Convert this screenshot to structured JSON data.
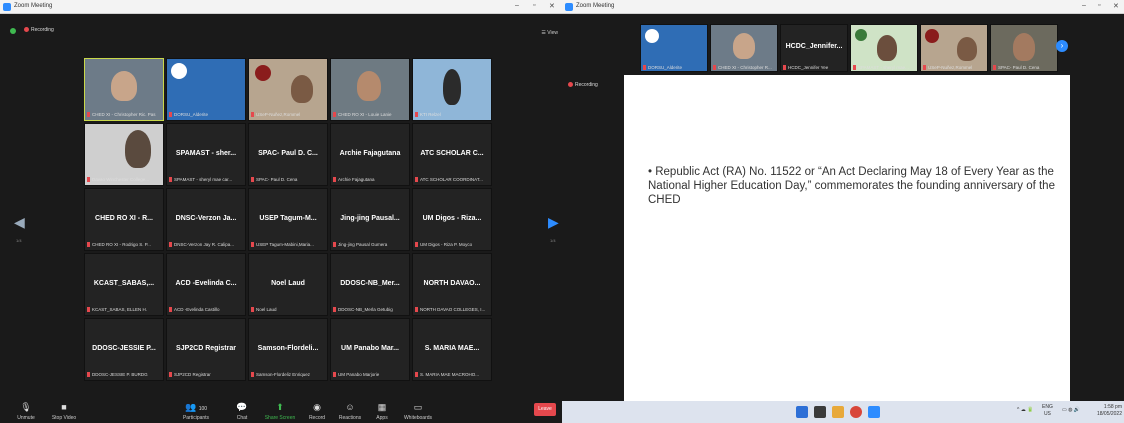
{
  "left_window": {
    "title": "Zoom Meeting",
    "recording": "Recording",
    "view": "View",
    "page_indicator": "1/4",
    "video_tiles": [
      {
        "name": "CHED XI - Christopher Ric. Pas"
      },
      {
        "name": "DORSU_Alderite"
      },
      {
        "name": "USeP-Nuñez,Rommel"
      },
      {
        "name": "CHED RO XI - Louie Lanie"
      },
      {
        "name": "KTI Relzel"
      },
      {
        "name": "Davao Winchester College..."
      }
    ],
    "text_tiles": [
      {
        "big": "SPAMAST - sher...",
        "name": "SPAMAST - sheryl mae car..."
      },
      {
        "big": "SPAC- Paul D. C...",
        "name": "SPAC- Paul D. Cena"
      },
      {
        "big": "Archie Fajagutana",
        "name": "Archie Fajagutana"
      },
      {
        "big": "ATC SCHOLAR C...",
        "name": "ATC SCHOLAR COORDINAT..."
      },
      {
        "big": "CHED RO XI - R...",
        "name": "CHED RO XI - Rodrigo S. P..."
      },
      {
        "big": "DNSC-Verzon Ja...",
        "name": "DNSC-Verzon Jay R. Calipa..."
      },
      {
        "big": "USEP Tagum-M...",
        "name": "USEP Tagum-Mabini,Maria..."
      },
      {
        "big": "Jing-jing Pausal...",
        "name": "Jing-jing Pausal Gumera"
      },
      {
        "big": "UM Digos - Riza...",
        "name": "UM Digos - Riza P. Moyco"
      },
      {
        "big": "KCAST_SABAS,...",
        "name": "KCAST_SABAS, ELLEN H."
      },
      {
        "big": "ACD -Evelinda C...",
        "name": "ACD -Evelinda Castillo"
      },
      {
        "big": "Noel Laud",
        "name": "Noel Laud"
      },
      {
        "big": "DDOSC-NB_Mer...",
        "name": "DDOSC-NB_Merla Getubig"
      },
      {
        "big": "NORTH DAVAO...",
        "name": "NORTH DAVAO COLLEGES, I..."
      },
      {
        "big": "DDOSC-JESSIE P...",
        "name": "DDOSC-JESSIE P. BURDG"
      },
      {
        "big": "SJP2CD Registrar",
        "name": "SJP2CD Registrar"
      },
      {
        "big": "Samson-Flordeli...",
        "name": "Samson-Flordeliz Enriquez"
      },
      {
        "big": "UM Panabo Mar...",
        "name": "UM Panabo Marjorie"
      },
      {
        "big": "S. MARIA MAE...",
        "name": "S. MARIA MAE MACROHO..."
      }
    ],
    "toolbar": {
      "unmute": "Unmute",
      "stop_video": "Stop Video",
      "participants": "Participants",
      "participants_count": "100",
      "chat": "Chat",
      "share_screen": "Share Screen",
      "record": "Record",
      "reactions": "Reactions",
      "apps": "Apps",
      "whiteboards": "Whiteboards",
      "leave": "Leave"
    }
  },
  "right_window": {
    "title": "Zoom Meeting",
    "recording": "Recording",
    "strip": [
      {
        "name": "DORSU_Alderite"
      },
      {
        "name": "CHED XI - Christopher R..."
      },
      {
        "name": "HCDC_Jennifer Yee",
        "big": "HCDC_Jennifer..."
      },
      {
        "name": "SPAMAST - sheryl mae..."
      },
      {
        "name": "USeP-Nuñez,Rommel"
      },
      {
        "name": "SPAC- Paul D. Cena"
      }
    ],
    "slide_text": "• Republic Act (RA) No. 11522 or “An Act Declaring May 18 of Every Year as the National Higher Education Day,” commemorates the founding anniversary of the CHED",
    "tray": {
      "lang": "ENG",
      "region": "US",
      "time": "1:58 pm",
      "date": "18/05/2022"
    }
  },
  "colors": {
    "accent": "#2d8cff",
    "leave": "#e5484d",
    "bg": "#1a1a1a"
  }
}
